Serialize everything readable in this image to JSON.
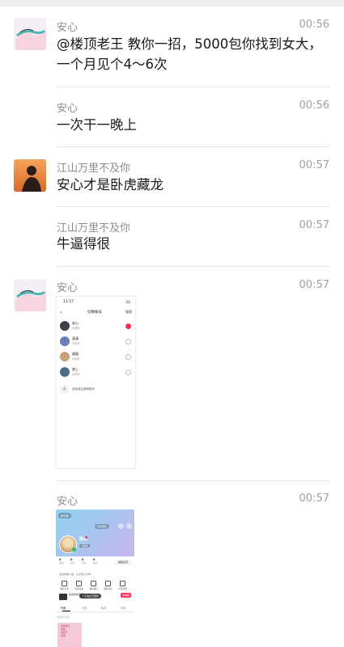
{
  "messages": [
    {
      "sender": "安心",
      "time": "00:56",
      "lines": [
        "@楼顶老王 教你一招，5000包你找到女大，",
        "一个月见个4～6次"
      ]
    },
    {
      "sender": "安心",
      "time": "00:56",
      "lines": [
        "一次干一晚上"
      ]
    },
    {
      "sender": "江山万里不及你",
      "time": "00:57",
      "lines": [
        "安心才是卧虎藏龙"
      ]
    },
    {
      "sender": "江山万里不及你",
      "time": "00:57",
      "lines": [
        "牛逼得很"
      ]
    },
    {
      "sender": "安心",
      "time": "00:57"
    },
    {
      "sender": "安心",
      "time": "00:57"
    }
  ],
  "shot1": {
    "status_time": "11:57",
    "signal": "5G",
    "title": "切换账号",
    "right": "管理",
    "accounts": [
      {
        "name": "安心",
        "sub": "抖音号",
        "selected": true,
        "color": "#3a3f4b"
      },
      {
        "name": "潇潇",
        "sub": "抖音号",
        "selected": false,
        "color": "#6a7fb4"
      },
      {
        "name": "猫猫",
        "sub": "抖音号",
        "selected": false,
        "color": "#c9a27a"
      },
      {
        "name": "夜上",
        "sub": "抖音号",
        "selected": false,
        "color": "#4a6d8c"
      }
    ],
    "add_label": "添加或注册新账号"
  },
  "shot2": {
    "visitor_btn": "新访客",
    "follow_btn": "添加朋友",
    "name": "指尖",
    "tag": "IP属地",
    "stats": [
      {
        "num": "0",
        "label": "获赞"
      },
      {
        "num": "0",
        "label": "互关"
      },
      {
        "num": "0",
        "label": "关注"
      },
      {
        "num": "0",
        "label": "粉丝"
      }
    ],
    "edit": "编辑主页",
    "bio_line": "点击添加介绍，让大家认识你...",
    "grid": [
      "我的订单",
      "抖音商城",
      "我的钱包",
      "我的书架",
      "全部功能"
    ],
    "music": "我喜欢的音乐",
    "toast": "个人信息已更新",
    "red_badge": "去看看",
    "tabs": [
      "作品",
      "日常",
      "私密",
      "喜欢"
    ],
    "sub": "仅自己可见",
    "card_text": "抖音账号\n切换\n多账号\n管理"
  },
  "colors": {
    "bg": "#ffffff",
    "text": "#191919",
    "meta": "#8c8c8c",
    "divider": "#e6e6e6",
    "accent": "#fe2c55"
  }
}
